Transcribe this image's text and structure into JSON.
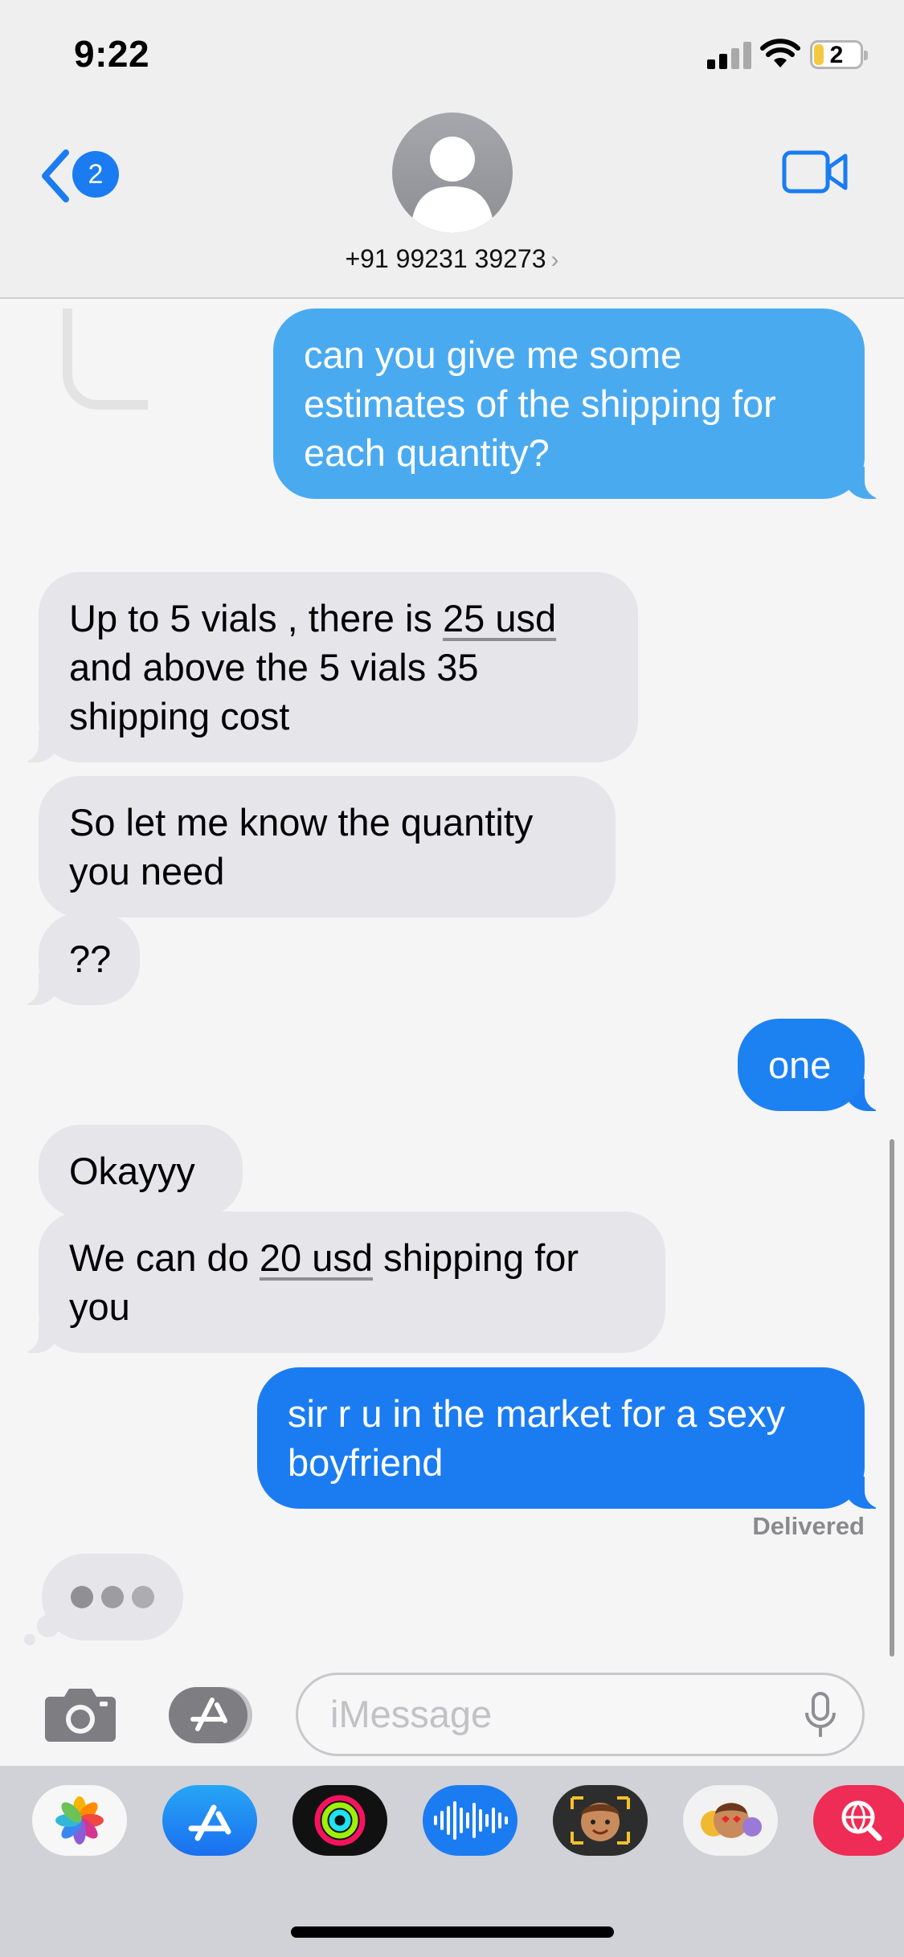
{
  "status_bar": {
    "time": "9:22",
    "battery_level": "2",
    "icons": [
      "cellular-signal-icon",
      "wifi-icon",
      "battery-icon"
    ]
  },
  "header": {
    "back_count": "2",
    "contact_name": "+91 99231 39273",
    "contact_chevron": "›",
    "icons": [
      "chevron-left-icon",
      "person-icon",
      "video-camera-icon"
    ]
  },
  "messages": [
    {
      "direction": "outgoing",
      "text_lines": [
        "can you give me some",
        "estimates of the shipping for",
        "each quantity?"
      ]
    },
    {
      "direction": "incoming",
      "pre": "Up to 5 vials , there is ",
      "link": "25 usd",
      "post": "and above the 5 vials 35",
      "post2": "shipping cost"
    },
    {
      "direction": "incoming",
      "text_lines": [
        "So let me know the quantity",
        "you need"
      ]
    },
    {
      "direction": "incoming",
      "text": "??"
    },
    {
      "direction": "outgoing",
      "text": "one"
    },
    {
      "direction": "incoming",
      "text": "Okayyy"
    },
    {
      "direction": "incoming",
      "pre": "We can do ",
      "link": "20 usd",
      "post": " shipping for",
      "post2": "you"
    },
    {
      "direction": "outgoing",
      "text_lines": [
        "sir r u in the market for a sexy",
        "boyfriend"
      ]
    }
  ],
  "delivery_status": "Delivered",
  "compose": {
    "placeholder": "iMessage",
    "icons": [
      "camera-icon",
      "app-store-icon",
      "microphone-icon"
    ]
  },
  "app_drawer": [
    "photos-app-icon",
    "app-store-app-icon",
    "activity-app-icon",
    "audio-message-icon",
    "memoji-app-icon",
    "memoji-stickers-icon",
    "web-search-app-icon"
  ],
  "colors": {
    "incoming_bubble": "#e5e5ea",
    "outgoing_light": "#4aaaf0",
    "outgoing_blue": "#1b7cf2",
    "link_blue": "#1a7cf0"
  }
}
